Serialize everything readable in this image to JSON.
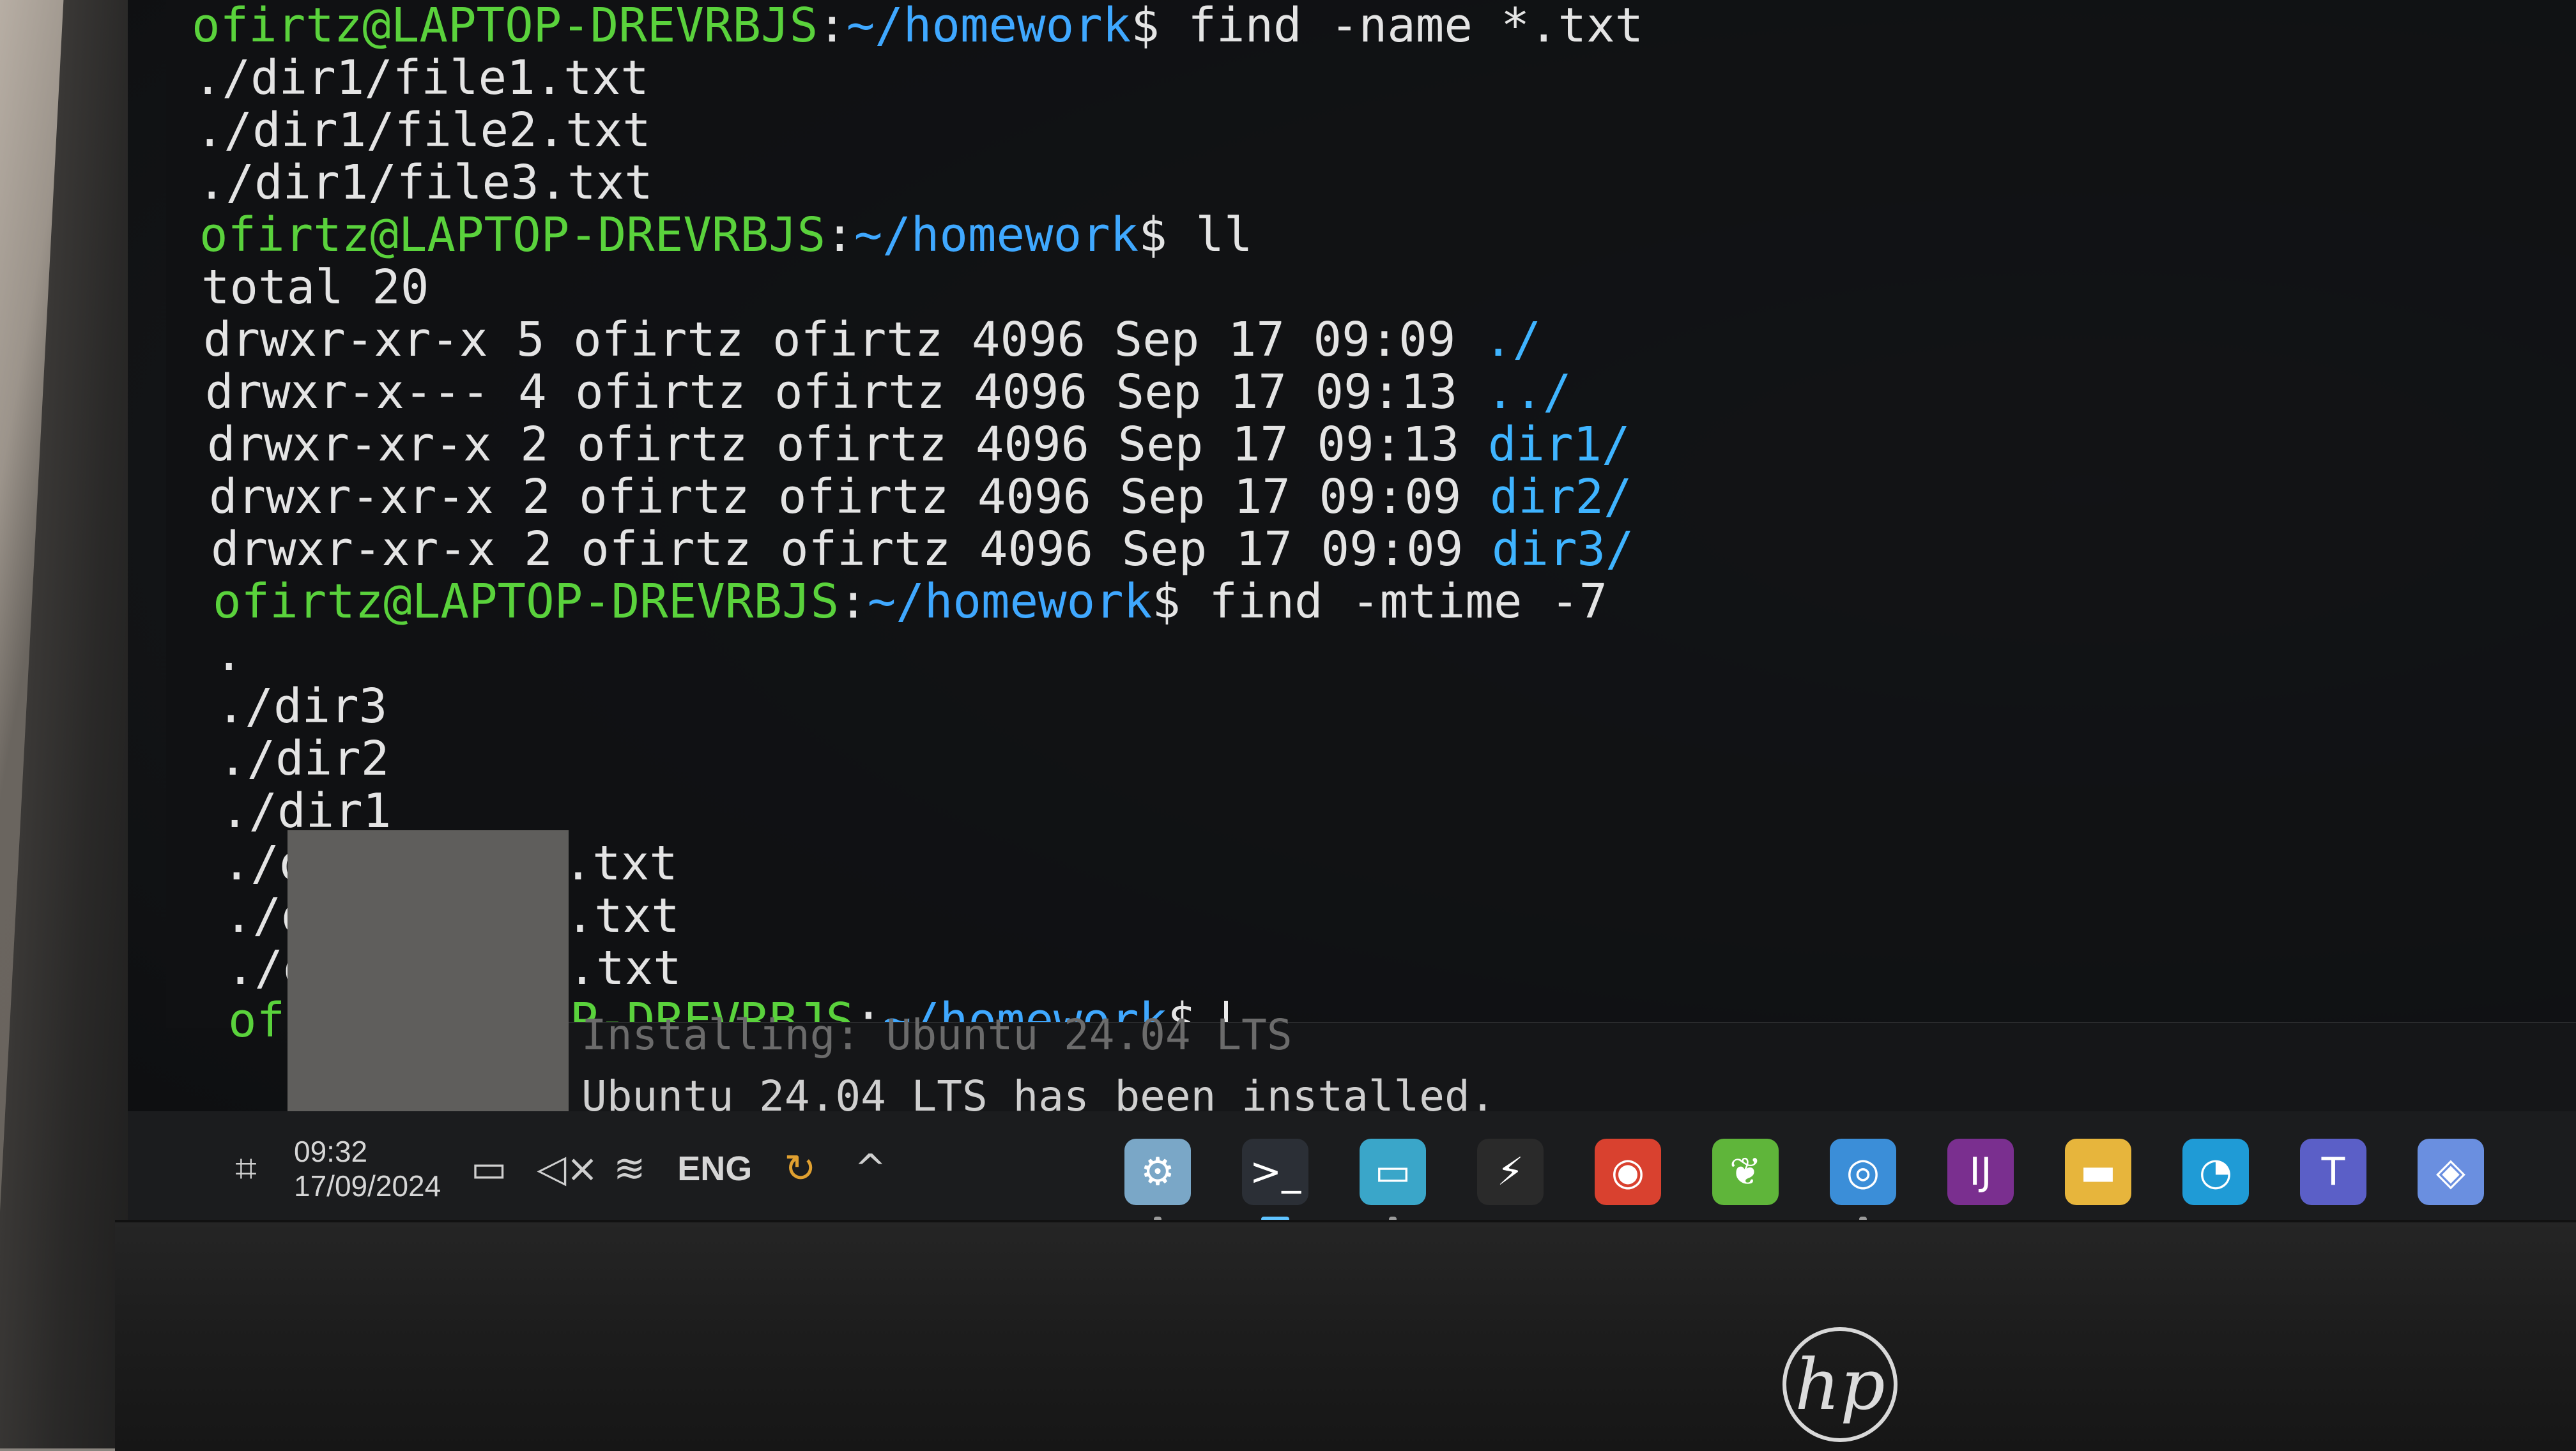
{
  "terminal": {
    "lines": [
      {
        "type": "cmd",
        "user": "ofirtz@LAPTOP-DREVRBJS",
        "sep": ":",
        "path": "~/homework",
        "dollar": "$",
        "command": " find -name *.txt"
      },
      {
        "type": "out",
        "text": "./dir1/file1.txt"
      },
      {
        "type": "out",
        "text": "./dir1/file2.txt"
      },
      {
        "type": "out",
        "text": "./dir1/file3.txt"
      },
      {
        "type": "cmd",
        "user": "ofirtz@LAPTOP-DREVRBJS",
        "sep": ":",
        "path": "~/homework",
        "dollar": "$",
        "command": " ll"
      },
      {
        "type": "out",
        "text": "total 20"
      },
      {
        "type": "ls",
        "text": "drwxr-xr-x 5 ofirtz ofirtz 4096 Sep 17 09:09 ",
        "name": "./"
      },
      {
        "type": "ls",
        "text": "drwxr-x--- 4 ofirtz ofirtz 4096 Sep 17 09:13 ",
        "name": "../"
      },
      {
        "type": "ls",
        "text": "drwxr-xr-x 2 ofirtz ofirtz 4096 Sep 17 09:13 ",
        "name": "dir1/"
      },
      {
        "type": "ls",
        "text": "drwxr-xr-x 2 ofirtz ofirtz 4096 Sep 17 09:09 ",
        "name": "dir2/"
      },
      {
        "type": "ls",
        "text": "drwxr-xr-x 2 ofirtz ofirtz 4096 Sep 17 09:09 ",
        "name": "dir3/"
      },
      {
        "type": "cmd",
        "user": "ofirtz@LAPTOP-DREVRBJS",
        "sep": ":",
        "path": "~/homework",
        "dollar": "$",
        "command": " find -mtime -7"
      },
      {
        "type": "out",
        "text": "."
      },
      {
        "type": "out",
        "text": "./dir3"
      },
      {
        "type": "out",
        "text": "./dir2"
      },
      {
        "type": "out",
        "text": "./dir1"
      },
      {
        "type": "out",
        "text": "./dir1/file1.txt"
      },
      {
        "type": "out",
        "text": "./dir1/file2.txt"
      },
      {
        "type": "out",
        "text": "./dir1/file3.txt"
      },
      {
        "type": "cmd",
        "user": "ofirtz@LAPTOP-DREVRBJS",
        "sep": ":",
        "path": "~/homework",
        "dollar": "$",
        "command": " ",
        "cursor": true
      }
    ],
    "colors": {
      "user": "#5ad23c",
      "path": "#3fa8ff",
      "dir": "#3fb4ff",
      "text": "#e4e4e4"
    }
  },
  "installer": {
    "status_faded": "Installing: Ubuntu 24.04 LTS",
    "status": "Ubuntu 24.04 LTS has been installed."
  },
  "taskbar": {
    "time": "09:32",
    "date": "17/09/2024",
    "language": "ENG",
    "tray_icons": [
      "notification-icon",
      "battery-icon",
      "volume-muted-icon",
      "wifi-icon"
    ],
    "apps": [
      {
        "name": "settings-app-icon",
        "glyph": "⚙",
        "color": "#7aa7c7",
        "state": "running"
      },
      {
        "name": "terminal-app-icon",
        "glyph": ">_",
        "color": "#2b2f36",
        "state": "active"
      },
      {
        "name": "remote-desktop-app-icon",
        "glyph": "▭",
        "color": "#3aa6c9",
        "state": "running"
      },
      {
        "name": "bolt-app-icon",
        "glyph": "⚡",
        "color": "#2a2a2a",
        "state": "none"
      },
      {
        "name": "recorder-app-icon",
        "glyph": "◉",
        "color": "#d9412f",
        "state": "none"
      },
      {
        "name": "spring-app-icon",
        "glyph": "❦",
        "color": "#5fb53a",
        "state": "none"
      },
      {
        "name": "chrome-app-icon",
        "glyph": "◎",
        "color": "#3b8ed8",
        "state": "running"
      },
      {
        "name": "intellij-app-icon",
        "glyph": "IJ",
        "color": "#7a2f8f",
        "state": "none"
      },
      {
        "name": "file-explorer-app-icon",
        "glyph": "▬",
        "color": "#e7b53c",
        "state": "none"
      },
      {
        "name": "edge-app-icon",
        "glyph": "◔",
        "color": "#1f9bd6",
        "state": "none"
      },
      {
        "name": "teams-app-icon",
        "glyph": "T",
        "color": "#5b5fc7",
        "state": "none"
      },
      {
        "name": "copilot-app-icon",
        "glyph": "◈",
        "color": "#6a8fe0",
        "state": "none"
      }
    ]
  },
  "brand": "hp"
}
